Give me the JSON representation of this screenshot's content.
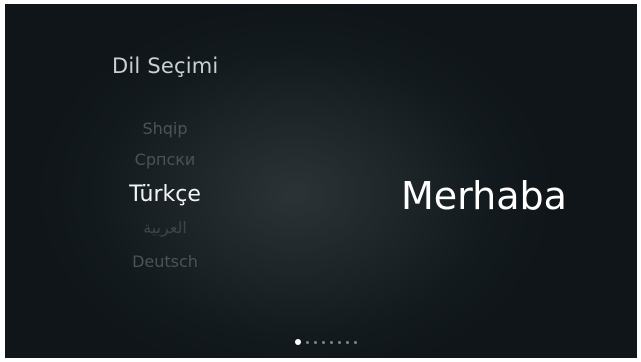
{
  "header": {
    "title": "Dil Seçimi"
  },
  "languages": [
    {
      "label": "Shqip"
    },
    {
      "label": "Српски"
    },
    {
      "label": "Türkçe",
      "selected": true
    },
    {
      "label": "العربية"
    },
    {
      "label": "Deutsch"
    }
  ],
  "preview": {
    "greeting": "Merhaba"
  },
  "pager": {
    "total": 8,
    "current": 1
  },
  "colors": {
    "background": "#1d2428",
    "selected_text": "#f2f4f5",
    "dimmed_text": "#4b5357"
  }
}
